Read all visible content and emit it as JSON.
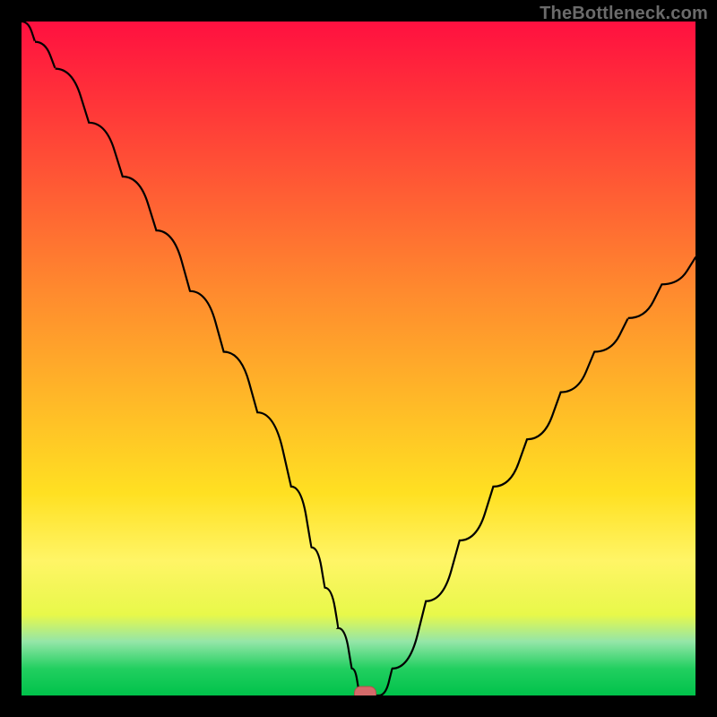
{
  "watermark": "TheBottleneck.com",
  "chart_data": {
    "type": "line",
    "title": "",
    "xlabel": "",
    "ylabel": "",
    "xlim": [
      0,
      100
    ],
    "ylim": [
      0,
      100
    ],
    "x": [
      0,
      2,
      5,
      10,
      15,
      20,
      25,
      30,
      35,
      40,
      43,
      45,
      47,
      49,
      50,
      51,
      53,
      55,
      60,
      65,
      70,
      75,
      80,
      85,
      90,
      95,
      100
    ],
    "values": [
      100,
      97,
      93,
      85,
      77,
      69,
      60,
      51,
      42,
      31,
      22,
      16,
      10,
      4,
      1,
      0,
      0,
      4,
      14,
      23,
      31,
      38,
      45,
      51,
      56,
      61,
      65
    ],
    "marker": {
      "x": 51,
      "y": 0
    },
    "background_gradient": [
      "#ff1040",
      "#ff2e3a",
      "#ff5c34",
      "#ff8a2e",
      "#ffb528",
      "#ffe022",
      "#fff566",
      "#e8f84a",
      "#94e6a8",
      "#22cf60",
      "#00c24a"
    ]
  }
}
